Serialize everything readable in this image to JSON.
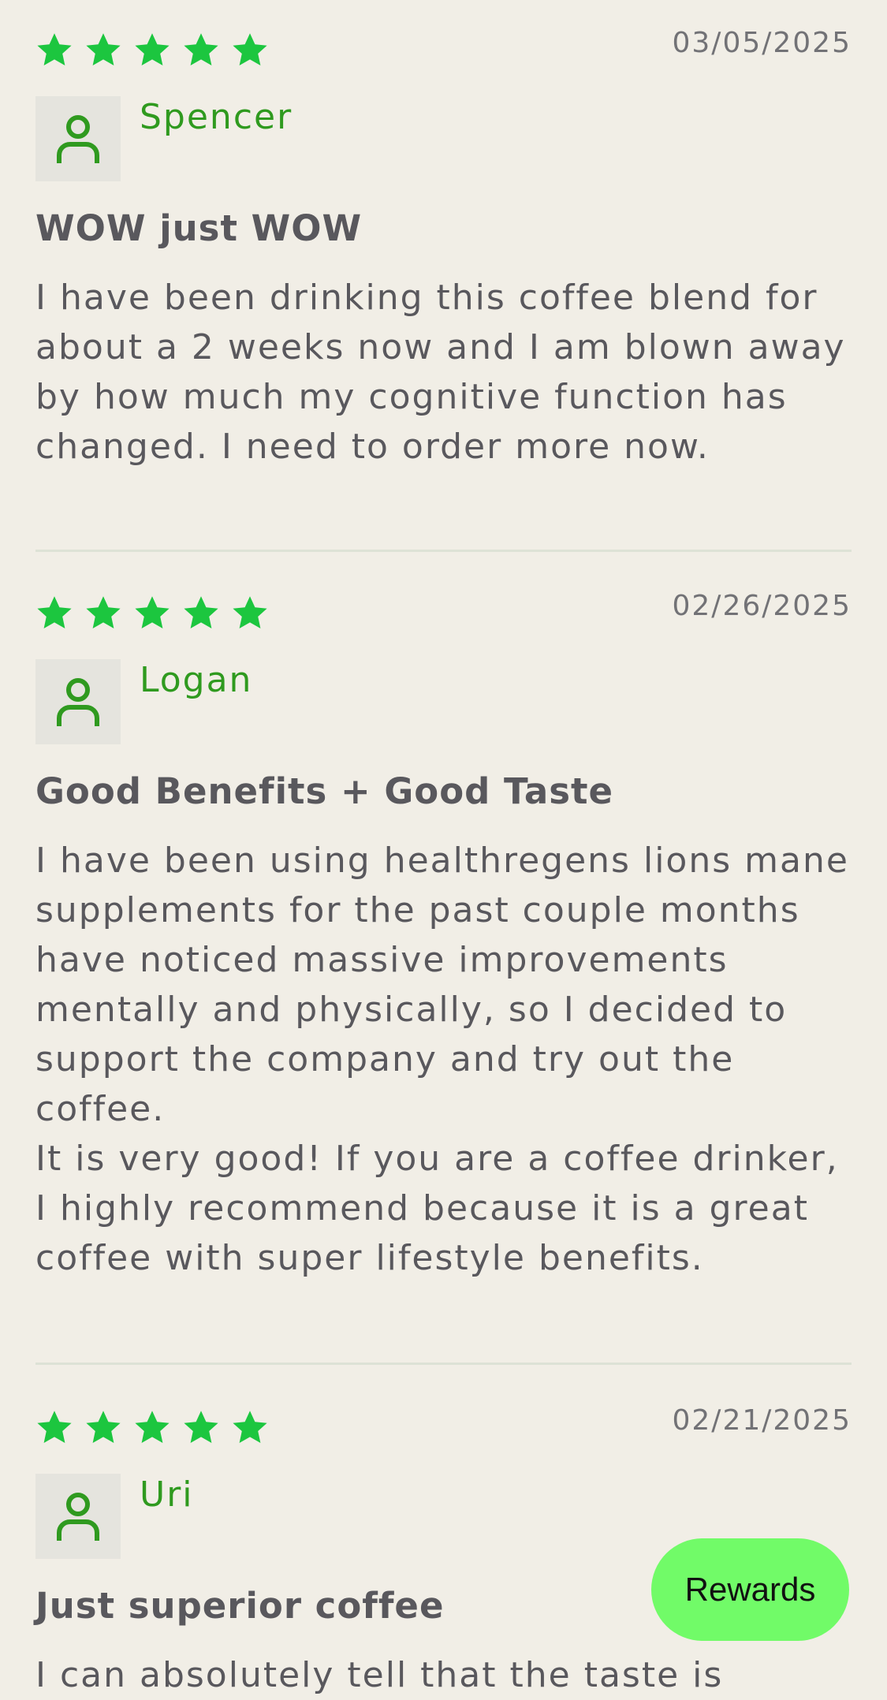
{
  "reviews": [
    {
      "rating": 5,
      "date": "03/05/2025",
      "author": "Spencer",
      "title": "WOW just WOW",
      "body": [
        "I have been drinking this coffee blend for about a 2 weeks now and I am blown away by how much my cognitive function has changed. I need to order more now."
      ]
    },
    {
      "rating": 5,
      "date": "02/26/2025",
      "author": "Logan",
      "title": "Good Benefits + Good Taste",
      "body": [
        "I have been using healthregens lions mane supplements for the past couple months have noticed massive improvements mentally and physically, so I decided to support the company and try out the coffee.",
        "It is very good! If you are a coffee drinker, I highly recommend because it is a great coffee with super lifestyle benefits."
      ]
    },
    {
      "rating": 5,
      "date": "02/21/2025",
      "author": "Uri",
      "title": "Just superior coffee",
      "body": [
        "I can absolutely tell that the taste is"
      ]
    }
  ],
  "rewards_button": {
    "label": "Rewards"
  },
  "colors": {
    "background": "#f1eee6",
    "star": "#1cc63f",
    "author": "#2f9a1f",
    "text": "#59585d",
    "avatar_bg": "#e5e4de",
    "rewards_bg": "#71fb68"
  },
  "icons": {
    "star": "star-icon",
    "avatar": "user-icon"
  }
}
